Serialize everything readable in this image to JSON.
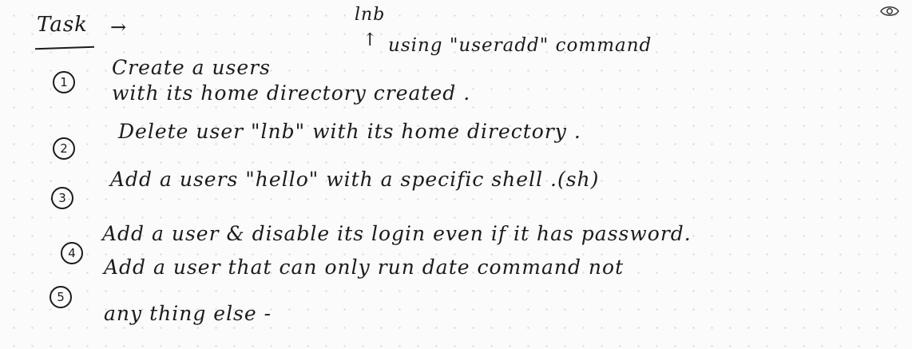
{
  "header": {
    "title": "Task",
    "arrow": "→"
  },
  "annotation": {
    "text": "lnb",
    "caret": "↑"
  },
  "tasks": [
    {
      "number": "1",
      "lines": [
        "Create  a   users",
        "using  \"useradd\"  command",
        "with  its  home  directory  created ."
      ]
    },
    {
      "number": "2",
      "lines": [
        "Delete  user  \"lnb\"   with  its  home  directory ."
      ]
    },
    {
      "number": "3",
      "lines": [
        "Add   a   users   \"hello\"   with  a  specific  shell .(sh)"
      ]
    },
    {
      "number": "4",
      "lines": [
        "Add  a  user  &  disable  its   login  even  if  it has  password."
      ]
    },
    {
      "number": "5",
      "lines": [
        "Add  a  user  that  can  only  run   date command  not",
        "any thing  else -"
      ]
    }
  ],
  "icons": {
    "visibility": "eye-icon"
  },
  "colors": {
    "ink": "#1b1b1b",
    "paper": "#fbfbfb",
    "grid_dot": "#d9d9d9"
  }
}
